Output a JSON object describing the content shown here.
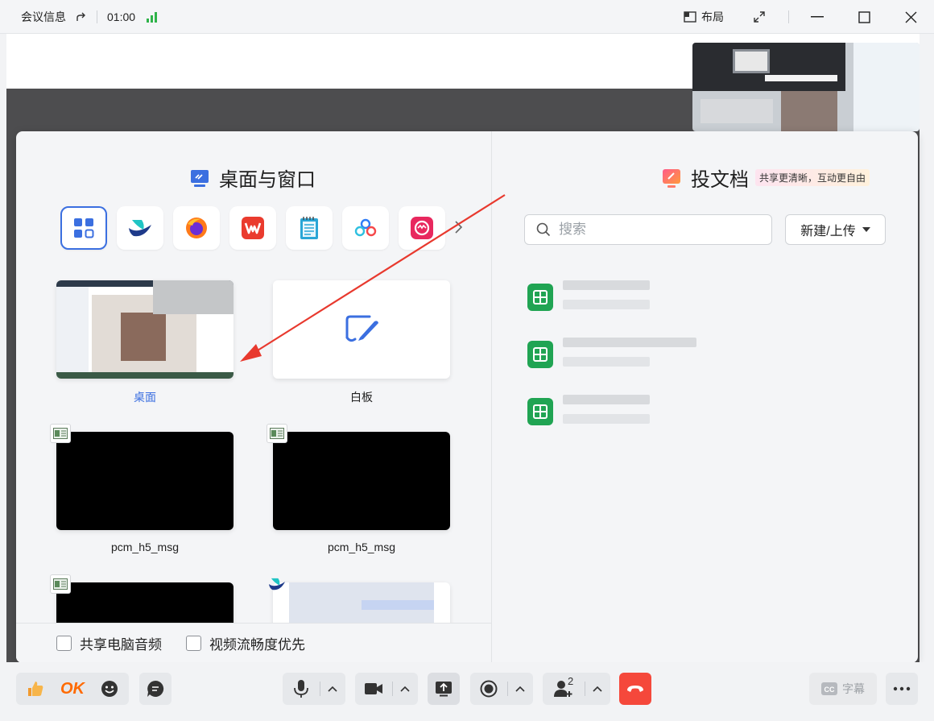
{
  "titlebar": {
    "meeting_info": "会议信息",
    "duration": "01:00",
    "layout_label": "布局"
  },
  "share_panel": {
    "left_title": "桌面与窗口",
    "right_title": "投文档",
    "promo_badge": "共享更清晰，互动更自由",
    "apps": [
      {
        "name": "all-apps",
        "icon": "grid-icon"
      },
      {
        "name": "feishu",
        "icon": "feishu-icon"
      },
      {
        "name": "firefox",
        "icon": "firefox-icon"
      },
      {
        "name": "wps",
        "icon": "wps-icon"
      },
      {
        "name": "notepad",
        "icon": "notepad-icon"
      },
      {
        "name": "cloud-app",
        "icon": "cloud-icon"
      },
      {
        "name": "meitu",
        "icon": "meitu-icon"
      }
    ],
    "sources": [
      {
        "label": "桌面"
      },
      {
        "label": "白板"
      },
      {
        "label": "pcm_h5_msg"
      },
      {
        "label": "pcm_h5_msg"
      }
    ],
    "options": {
      "share_audio": "共享电脑音频",
      "video_smooth": "视频流畅度优先"
    },
    "search": {
      "placeholder": "搜索"
    },
    "new_upload": "新建/上传"
  },
  "toolbar": {
    "ok_label": "OK",
    "participants_count": "2",
    "caption_label": "字幕",
    "hangup_color": "#f5483b"
  },
  "colors": {
    "accent": "#3b6fe0",
    "sheet_green": "#20a453",
    "signal_green": "#2fb34a"
  }
}
